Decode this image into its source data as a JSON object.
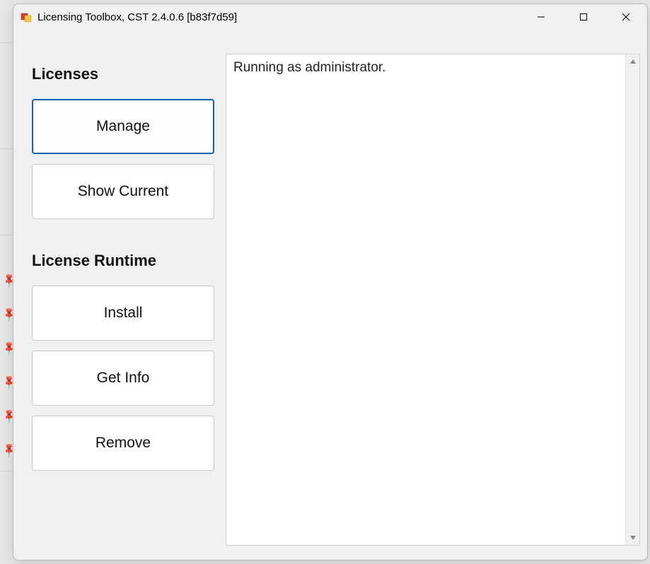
{
  "window": {
    "title": "Licensing Toolbox, CST 2.4.0.6 [b83f7d59]"
  },
  "sections": {
    "licenses": {
      "heading": "Licenses",
      "buttons": {
        "manage": "Manage",
        "show_current": "Show Current"
      }
    },
    "runtime": {
      "heading": "License Runtime",
      "buttons": {
        "install": "Install",
        "get_info": "Get Info",
        "remove": "Remove"
      }
    }
  },
  "log": {
    "text": "Running as administrator."
  }
}
